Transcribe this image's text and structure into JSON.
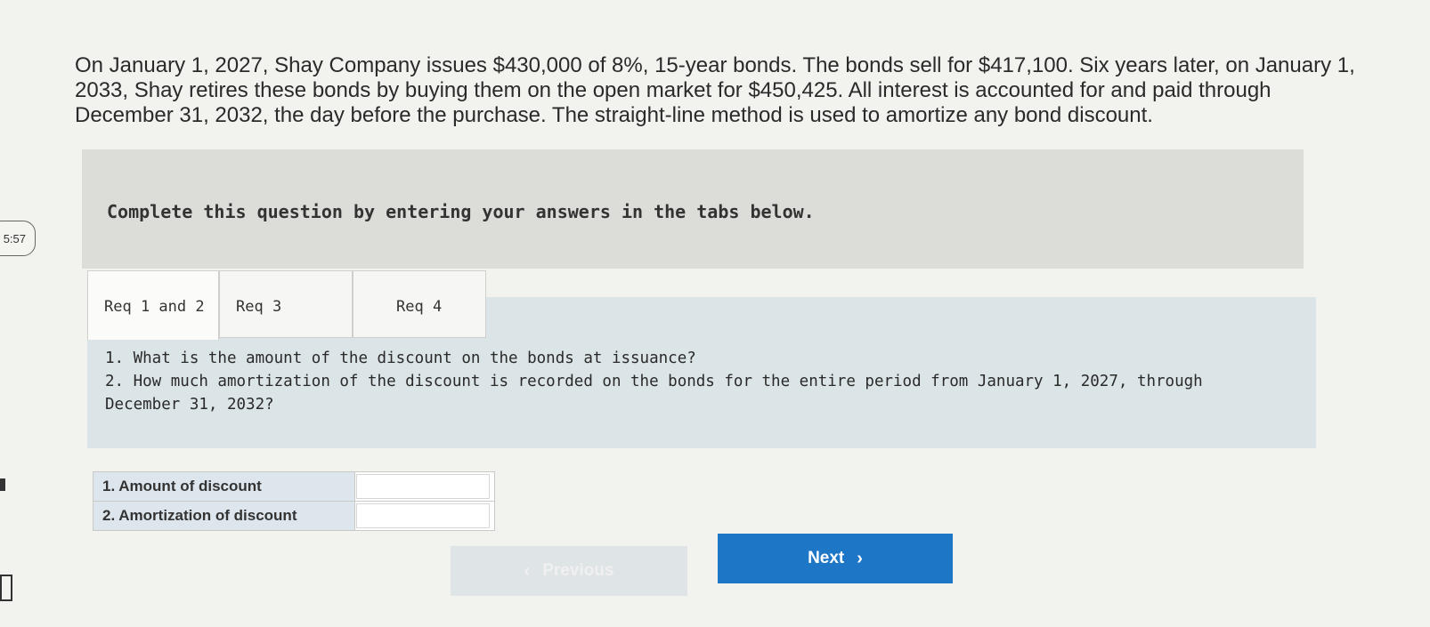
{
  "problem": {
    "text": "On January 1, 2027, Shay Company issues $430,000 of 8%, 15-year bonds. The bonds sell for $417,100. Six years later, on January 1, 2033, Shay retires these bonds by buying them on the open market for $450,425. All interest is accounted for and paid through December 31, 2032, the day before the purchase. The straight-line method is used to amortize any bond discount."
  },
  "timer": {
    "text": "5:57"
  },
  "instruction": "Complete this question by entering your answers in the tabs below.",
  "tabs": [
    {
      "label": "Req 1 and 2",
      "active": true
    },
    {
      "label": "Req 3",
      "active": false
    },
    {
      "label": "Req 4",
      "active": false
    }
  ],
  "questions": {
    "q1": "1. What is the amount of the discount on the bonds at issuance?",
    "q2": "2. How much amortization of the discount is recorded on the bonds for the entire period from January 1, 2027, through December 31, 2032?"
  },
  "answers": [
    {
      "label": "1. Amount of discount",
      "value": ""
    },
    {
      "label": "2. Amortization of discount",
      "value": ""
    }
  ],
  "nav": {
    "previous_label": "Previous",
    "next_label": "Next",
    "previous_icon": "chevron-left-icon",
    "next_icon": "chevron-right-icon"
  },
  "colors": {
    "next_button": "#1e76c7",
    "answer_label_bg": "#dde6ec",
    "content_panel_bg": "#dbe4e7"
  }
}
